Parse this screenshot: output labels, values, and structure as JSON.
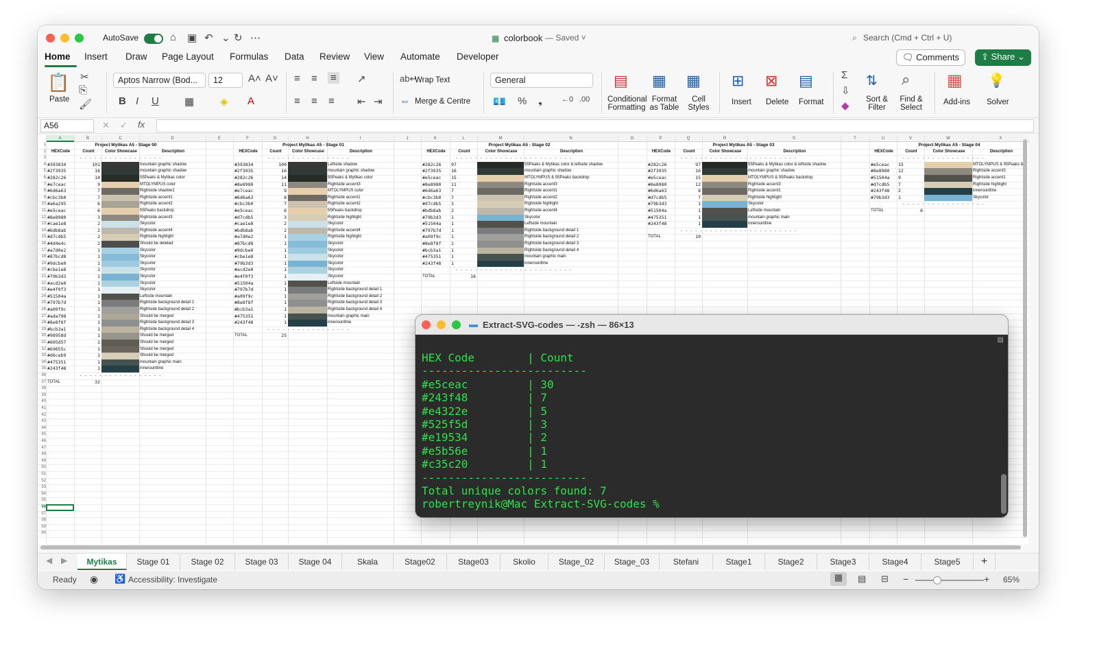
{
  "window": {
    "title": "colorbook",
    "saved": "— Saved ˅",
    "autosave": "AutoSave",
    "search_placeholder": "Search (Cmd + Ctrl + U)"
  },
  "menus": [
    "Home",
    "Insert",
    "Draw",
    "Page Layout",
    "Formulas",
    "Data",
    "Review",
    "View",
    "Automate",
    "Developer"
  ],
  "buttons": {
    "comments": "Comments",
    "share": "Share"
  },
  "ribbon": {
    "paste": "Paste",
    "font_name": "Aptos Narrow (Bod...",
    "font_size": "12",
    "wrap_text": "Wrap Text",
    "merge": "Merge & Centre",
    "number_format": "General",
    "conditional": "Conditional",
    "formatting": "Formatting",
    "format_as": "Format",
    "as_table": "as Table",
    "cell": "Cell",
    "styles": "Styles",
    "insert": "Insert",
    "delete": "Delete",
    "format": "Format",
    "sort": "Sort &",
    "filter": "Filter",
    "find": "Find &",
    "select": "Select",
    "addins": "Add-ins",
    "solver": "Solver"
  },
  "namebox": "A56",
  "sheet": {
    "col_letters": [
      "A",
      "B",
      "C",
      "D",
      "E",
      "F",
      "G",
      "H",
      "I",
      "J",
      "K",
      "L",
      "M",
      "N",
      "O",
      "P",
      "Q",
      "R",
      "S",
      "T",
      "U",
      "V",
      "W",
      "X"
    ],
    "headers": {
      "hex": "HEXCode",
      "count": "Count",
      "showcase": "Color Showcase",
      "desc": "Description"
    },
    "dashes": "- - - - - - - - - - - - - - - - - - - - - - - -",
    "total_label": "TOTAL",
    "blocks": [
      {
        "title": "Project Mytikas A5 - Stage 00",
        "total": "32",
        "rows": [
          [
            "#393834",
            "101",
            "mountain graphic shadow",
            "#393834"
          ],
          [
            "#2f3935",
            "16",
            "mountain graphic shadow",
            "#2f3935"
          ],
          [
            "#282c26",
            "14",
            "55Peaks & Mytikas color",
            "#282c26"
          ],
          [
            "#e7ceac",
            "9",
            "MTOLYMPUS color",
            "#e7ceac"
          ],
          [
            "#6d6a63",
            "7",
            "Rightside shadow1",
            "#6d6a63"
          ],
          [
            "#cbc3b0",
            "7",
            "Rightside accent1",
            "#cbc3b0"
          ],
          [
            "#a6a295",
            "6",
            "Rightside accent2",
            "#a6a295"
          ],
          [
            "#e5ceac",
            "6",
            "55Peaks backdrop",
            "#e5ceac"
          ],
          [
            "#8e8980",
            "3",
            "Rightside accent3",
            "#8e8980"
          ],
          [
            "#cae1e8",
            "2",
            "Skycolor",
            "#cae1e8"
          ],
          [
            "#bdb8ab",
            "2",
            "Rightside accent4",
            "#bdb8ab"
          ],
          [
            "#d7cdb5",
            "2",
            "Rightside highlight",
            "#d7cdb5"
          ],
          [
            "#4d4e4c",
            "2",
            "Should be deleted",
            "#4d4e4c"
          ],
          [
            "#a7d0e2",
            "1",
            "Skycolor",
            "#a7d0e2"
          ],
          [
            "#87bcd8",
            "1",
            "Skycolor",
            "#87bcd8"
          ],
          [
            "#9dcbe0",
            "1",
            "Skycolor",
            "#9dcbe0"
          ],
          [
            "#cbe1e8",
            "1",
            "Skycolor",
            "#cbe1e8"
          ],
          [
            "#79b3d3",
            "1",
            "Skycolor",
            "#79b3d3"
          ],
          [
            "#acd2e0",
            "1",
            "Skycolor",
            "#acd2e0"
          ],
          [
            "#e4f0f3",
            "1",
            "Skycolor",
            "#e4f0f3"
          ],
          [
            "#51504a",
            "1",
            "Leftside mountain",
            "#51504a"
          ],
          [
            "#797b7d",
            "1",
            "Rightside background detail 1",
            "#797b7d"
          ],
          [
            "#a09f9c",
            "1",
            "Rightside background detail 2",
            "#a09f9c"
          ],
          [
            "#ada798",
            "1",
            "Should be merged",
            "#ada798"
          ],
          [
            "#8e8f8f",
            "1",
            "Rightside background detail 3",
            "#8e8f8f"
          ],
          [
            "#bcb3a1",
            "1",
            "Rightside background detail 4",
            "#bcb3a1"
          ],
          [
            "#98958d",
            "1",
            "Should be merged",
            "#98958d"
          ],
          [
            "#605d57",
            "1",
            "Should be merged",
            "#605d57"
          ],
          [
            "#69655c",
            "1",
            "Should be merged",
            "#69655c"
          ],
          [
            "#d6ceb9",
            "1",
            "Should be merged",
            "#d6ceb9"
          ],
          [
            "#475351",
            "1",
            "mountain graphic main",
            "#475351"
          ],
          [
            "#243f48",
            "1",
            "innerountline",
            "#243f48"
          ]
        ]
      },
      {
        "title": "Project Mytikas A5 - Stage 01",
        "total": "25",
        "rows": [
          [
            "#393834",
            "100",
            "Leftside shadow",
            "#393834"
          ],
          [
            "#2f3935",
            "16",
            "mountain graphic shadow",
            "#2f3935"
          ],
          [
            "#282c26",
            "14",
            "55Peaks & Mytikas color",
            "#282c26"
          ],
          [
            "#8e8980",
            "11",
            "Rightside accent3",
            "#8e8980"
          ],
          [
            "#e7ceac",
            "9",
            "MTOLYMPUS color",
            "#e7ceac"
          ],
          [
            "#6d6a63",
            "8",
            "Rightside accent1",
            "#6d6a63"
          ],
          [
            "#cbc3b0",
            "7",
            "Rightside accent2",
            "#cbc3b0"
          ],
          [
            "#e5ceac",
            "6",
            "55Peaks backdrop",
            "#e5ceac"
          ],
          [
            "#d7cdb5",
            "3",
            "Rightside highlight",
            "#d7cdb5"
          ],
          [
            "#cae1e8",
            "2",
            "Skycolor",
            "#cae1e8"
          ],
          [
            "#bdb8ab",
            "2",
            "Rightside accent4",
            "#bdb8ab"
          ],
          [
            "#a7d0e2",
            "1",
            "Rightside highlight",
            "#a7d0e2"
          ],
          [
            "#87bcd8",
            "1",
            "Skycolor",
            "#87bcd8"
          ],
          [
            "#9dcbe0",
            "1",
            "Skycolor",
            "#9dcbe0"
          ],
          [
            "#cbe1e8",
            "1",
            "Skycolor",
            "#cbe1e8"
          ],
          [
            "#79b3d3",
            "1",
            "Skycolor",
            "#79b3d3"
          ],
          [
            "#acd2e0",
            "1",
            "Skycolor",
            "#acd2e0"
          ],
          [
            "#e4f0f3",
            "1",
            "Skycolor",
            "#e4f0f3"
          ],
          [
            "#51504a",
            "1",
            "Leftside mountain",
            "#51504a"
          ],
          [
            "#797b7d",
            "1",
            "Rightside background detail 1",
            "#797b7d"
          ],
          [
            "#a09f9c",
            "1",
            "Rightside background detail 2",
            "#a09f9c"
          ],
          [
            "#8e8f8f",
            "1",
            "Rightside background detail 3",
            "#8e8f8f"
          ],
          [
            "#bcb3a1",
            "1",
            "Rightside background detail 4",
            "#bcb3a1"
          ],
          [
            "#475351",
            "1",
            "mountain graphic main",
            "#475351"
          ],
          [
            "#243f48",
            "1",
            "innerountline",
            "#243f48"
          ]
        ]
      },
      {
        "title": "Project Mytikas A5 - Stage 02",
        "total": "16",
        "rows": [
          [
            "#282c26",
            "97",
            "55Peaks & Mytikas color & leftside shadow",
            "#282c26"
          ],
          [
            "#2f3935",
            "16",
            "mountain graphic shadow",
            "#2f3935"
          ],
          [
            "#e5ceac",
            "15",
            "MTOLYMPUS & 55Peaks backdrop",
            "#e5ceac"
          ],
          [
            "#8e8980",
            "11",
            "Rightside accent3",
            "#8e8980"
          ],
          [
            "#6d6a63",
            "7",
            "Rightside accent1",
            "#6d6a63"
          ],
          [
            "#cbc3b0",
            "7",
            "Rightside accent2",
            "#cbc3b0"
          ],
          [
            "#d7cdb5",
            "3",
            "Rightside highlight",
            "#d7cdb5"
          ],
          [
            "#bdb8ab",
            "2",
            "Rightside accent4",
            "#bdb8ab"
          ],
          [
            "#79b3d3",
            "1",
            "Skycolor",
            "#79b3d3"
          ],
          [
            "#51504a",
            "1",
            "Leftside mountain",
            "#51504a"
          ],
          [
            "#797b7d",
            "1",
            "Rightside background detail 1",
            "#797b7d"
          ],
          [
            "#a09f9c",
            "1",
            "Rightside background detail 2",
            "#a09f9c"
          ],
          [
            "#8e8f8f",
            "1",
            "Rightside background detail 3",
            "#8e8f8f"
          ],
          [
            "#bcb3a1",
            "1",
            "Rightside background detail 4",
            "#bcb3a1"
          ],
          [
            "#475351",
            "1",
            "mountain graphic main",
            "#475351"
          ],
          [
            "#243f48",
            "1",
            "innerountline",
            "#243f48"
          ]
        ]
      },
      {
        "title": "Project Mytikas A5 - Stage 03",
        "total": "10",
        "rows": [
          [
            "#282c26",
            "97",
            "55Peaks & Mytikas color & leftside shadow",
            "#282c26"
          ],
          [
            "#2f3935",
            "16",
            "mountain graphic shadow",
            "#2f3935"
          ],
          [
            "#e5ceac",
            "15",
            "MTOLYMPUS & 55Peaks backdrop",
            "#e5ceac"
          ],
          [
            "#8e8980",
            "12",
            "Rightside accent3",
            "#8e8980"
          ],
          [
            "#6d6a63",
            "8",
            "Rightside accent1",
            "#6d6a63"
          ],
          [
            "#d7cdb5",
            "7",
            "Rightside highlight",
            "#d7cdb5"
          ],
          [
            "#79b3d3",
            "1",
            "Skycolor",
            "#79b3d3"
          ],
          [
            "#51504a",
            "1",
            "Leftside mountain",
            "#51504a"
          ],
          [
            "#475351",
            "1",
            "mountain graphic main",
            "#475351"
          ],
          [
            "#243f48",
            "1",
            "innerountline",
            "#243f48"
          ]
        ]
      },
      {
        "title": "Project Mytikas A5 - Stage 04",
        "total": "6",
        "rows": [
          [
            "#e5ceac",
            "15",
            "MTOLYMPUS & 55Peaks b",
            "#e5ceac"
          ],
          [
            "#8e8980",
            "12",
            "Rightside accent3",
            "#8e8980"
          ],
          [
            "#51504a",
            "9",
            "Rightside accent1",
            "#51504a"
          ],
          [
            "#d7cdb5",
            "7",
            "Rightside highlight",
            "#d7cdb5"
          ],
          [
            "#243f48",
            "2",
            "innerountline",
            "#243f48"
          ],
          [
            "#79b3d3",
            "1",
            "Skycolor",
            "#79b3d3"
          ]
        ]
      }
    ]
  },
  "terminal": {
    "title": "Extract-SVG-codes — -zsh — 86×13",
    "lines": [
      "HEX Code        | Count",
      "-------------------------",
      "#e5ceac         | 30",
      "#243f48         | 7",
      "#e4322e         | 5",
      "#525f5d         | 3",
      "#e19534         | 2",
      "#e5b56e         | 1",
      "#c35c20         | 1",
      "-------------------------",
      "Total unique colors found: 7",
      "robertreynik@Mac Extract-SVG-codes %"
    ]
  },
  "tabs": [
    "Mytikas",
    "Stage 01",
    "Stage 02",
    "Stage 03",
    "Stage 04",
    "Skala",
    "Stage02",
    "Stage03",
    "Skolio",
    "Stage_02",
    "Stage_03",
    "Stefani",
    "Stage1",
    "Stage2",
    "Stage3",
    "Stage4",
    "Stage5"
  ],
  "status": {
    "ready": "Ready",
    "accessibility": "Accessibility: Investigate",
    "zoom": "65%"
  },
  "colors": {
    "accent": "#1e7c45",
    "terminal_text": "#2ee34a",
    "terminal_bg": "#2b2b2b"
  }
}
